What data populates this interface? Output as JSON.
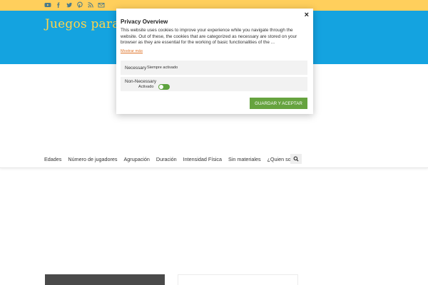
{
  "colors": {
    "topbar": "#ffcf5c",
    "hero": "#14a3e0",
    "title": "#ffd54a",
    "accept_button": "#66a33f",
    "toggle_on": "#5ea33f",
    "more_link": "#e0752a"
  },
  "header": {
    "site_title": "Juegos para n",
    "social_icons": [
      "youtube-icon",
      "facebook-icon",
      "twitter-icon",
      "pinterest-icon",
      "rss-icon",
      "email-icon"
    ]
  },
  "nav": {
    "items": [
      "Edades",
      "Número de jugadores",
      "Agrupación",
      "Duración",
      "Intensidad Física",
      "Sin materiales",
      "¿Quien soy?"
    ],
    "search_icon": "search-icon"
  },
  "modal": {
    "title": "Privacy Overview",
    "close": "×",
    "body": "This website uses cookies to improve your experience while you navigate through the website. Out of these, the cookies that are categorized as necessary are stored on your browser as they are essential for the working of basic functionalities of the ...",
    "more_link": "Mostrar más",
    "rows": [
      {
        "label": "Necessary",
        "status": "Siempre activado"
      },
      {
        "label": "Non-Necessary",
        "status": "Activado",
        "toggle_on": true
      }
    ],
    "accept_button": "GUARDAR Y ACEPTAR"
  }
}
